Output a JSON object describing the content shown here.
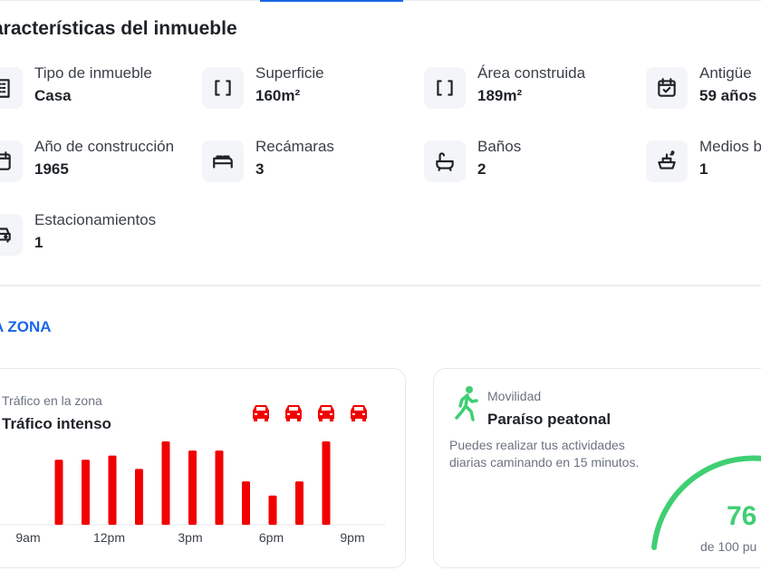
{
  "features": {
    "title": "aracterísticas del inmueble",
    "items": [
      {
        "label": "Tipo de inmueble",
        "value": "Casa",
        "icon": "building-icon"
      },
      {
        "label": "Superficie",
        "value": "160m²",
        "icon": "area-brackets-icon"
      },
      {
        "label": "Área construida",
        "value": "189m²",
        "icon": "area-brackets-icon"
      },
      {
        "label": "Antigüe",
        "value": "59 años",
        "icon": "calendar-check-icon"
      },
      {
        "label": "Año de construcción",
        "value": "1965",
        "icon": "calendar-icon"
      },
      {
        "label": "Recámaras",
        "value": "3",
        "icon": "bed-icon"
      },
      {
        "label": "Baños",
        "value": "2",
        "icon": "bathtub-icon"
      },
      {
        "label": "Medios b",
        "value": "1",
        "icon": "sink-icon"
      },
      {
        "label": "Estacionamientos",
        "value": "1",
        "icon": "car-icon"
      }
    ]
  },
  "zone": {
    "title": "A ZONA",
    "traffic": {
      "label": "Tráfico en la zona",
      "value": "Tráfico intenso",
      "cars_icon": "car-icon",
      "color": "#f20000"
    },
    "mobility": {
      "label": "Movilidad",
      "value": "Paraíso peatonal",
      "description": "Puedes realizar tus actividades diarias caminando en 15 minutos.",
      "score": "76",
      "score_suffix": "de 100 pu",
      "icon": "walking-person-icon",
      "color": "#3fcf73"
    }
  },
  "chart_data": {
    "type": "bar",
    "x_tick_labels": [
      "9am",
      "12pm",
      "3pm",
      "6pm",
      "9pm"
    ],
    "values": [
      0.78,
      0.78,
      0.83,
      0.67,
      1.0,
      0.89,
      0.89,
      0.52,
      0.35,
      0.52,
      1.0
    ],
    "color": "#f20000",
    "grid": false
  }
}
